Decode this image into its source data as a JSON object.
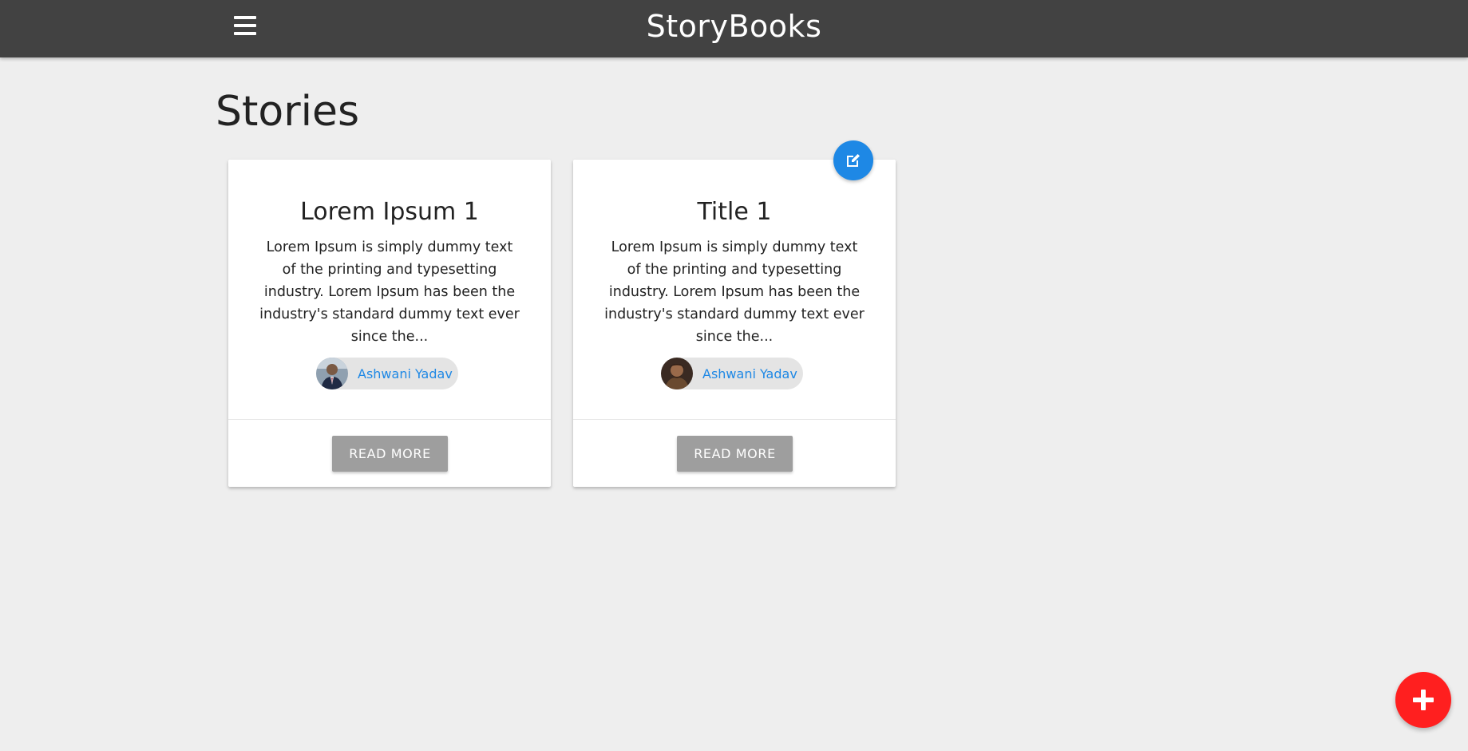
{
  "navbar": {
    "brand": "StoryBooks",
    "menu_icon": "hamburger-menu-icon"
  },
  "page": {
    "title": "Stories"
  },
  "stories": [
    {
      "title": "Lorem Ipsum 1",
      "body": "Lorem Ipsum is simply dummy text of the printing and typesetting industry. Lorem Ipsum has been the industry's standard dummy text ever since the...",
      "author": "Ashwani Yadav",
      "action_label": "READ MORE",
      "editable": false
    },
    {
      "title": "Title 1",
      "body": "Lorem Ipsum is simply dummy text of the printing and typesetting industry. Lorem Ipsum has been the industry's standard dummy text ever since the...",
      "author": "Ashwani Yadav",
      "action_label": "READ MORE",
      "editable": true
    }
  ],
  "fab": {
    "add_icon": "plus-icon",
    "edit_icon": "edit-icon"
  },
  "colors": {
    "navbar": "#424242",
    "background": "#eeeeee",
    "accent_blue": "#1e88e5",
    "add_red": "#ff1f1f",
    "button_grey": "#9e9e9e"
  }
}
